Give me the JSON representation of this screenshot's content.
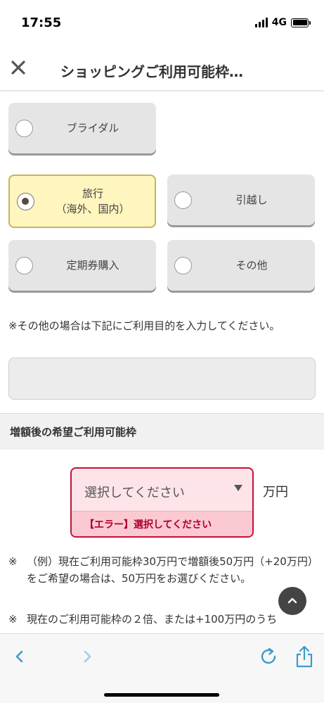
{
  "status_bar": {
    "time": "17:55",
    "network": "4G"
  },
  "header": {
    "title": "ショッピングご利用可能枠…"
  },
  "options": [
    {
      "label": "ブライダル",
      "selected": false
    },
    {
      "label": "旅行\n（海外、国内）",
      "selected": true
    },
    {
      "label": "引越し",
      "selected": false
    },
    {
      "label": "定期券購入",
      "selected": false
    },
    {
      "label": "その他",
      "selected": false
    }
  ],
  "other_note": "※その他の場合は下記にご利用目的を入力してください。",
  "other_input": {
    "value": "",
    "placeholder": ""
  },
  "section": {
    "title": "増額後の希望ご利用可能枠"
  },
  "amount_select": {
    "value": "選択してください",
    "error": "【エラー】選択してください",
    "unit": "万円"
  },
  "notes": [
    {
      "mark": "※",
      "text": "（例）現在ご利用可能枠30万円で増額後50万円（+20万円）をご希望の場合は、50万円をお選びください。"
    },
    {
      "mark": "※",
      "text": "現在のご利用可能枠の２倍、または+100万円のうち"
    }
  ],
  "colors": {
    "error": "#c8103c",
    "selected_bg": "#fff5bf",
    "toolbar_icon": "#3a9cc6"
  },
  "icons": {
    "close": "close-icon",
    "back": "chevron-left-icon",
    "forward": "chevron-right-icon",
    "reload": "reload-icon",
    "share": "share-icon",
    "scroll_top": "chevron-up-icon"
  }
}
